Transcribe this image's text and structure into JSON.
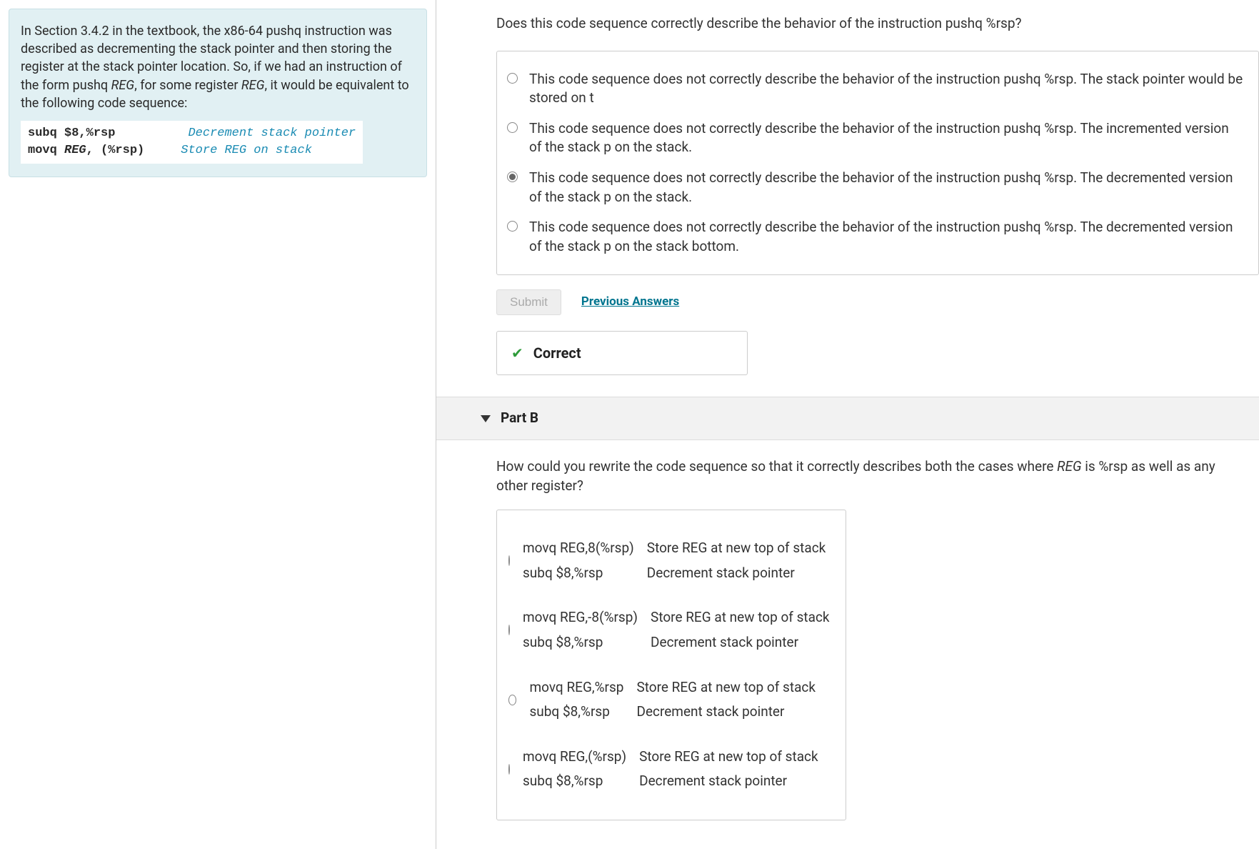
{
  "left": {
    "intro_html": "In Section 3.4.2 in the textbook, the x86-64 pushq instruction was described as decrementing the stack pointer and then storing the register at the stack pointer location. So, if we had an instruction of the form pushq <span class='reg-em'>REG</span>, for some register <span class='reg-em'>REG</span>, it would be equivalent to the following code sequence:",
    "code": {
      "l1_instr": "subq $8,%rsp",
      "l1_pad": "          ",
      "l1_comment": "Decrement stack pointer",
      "l2_instr_a": "movq ",
      "l2_instr_b": "REG",
      "l2_instr_c": ", (%rsp)",
      "l2_pad": "     ",
      "l2_comment": "Store REG on stack"
    }
  },
  "partA": {
    "prompt": "Does this code sequence correctly describe the behavior of the instruction pushq %rsp?",
    "options": [
      "This code sequence does not correctly describe the behavior of the instruction pushq %rsp. The stack pointer would be stored on t",
      "This code sequence does not correctly describe the behavior of the instruction pushq %rsp. The incremented version of the stack p on the stack.",
      "This code sequence does not correctly describe the behavior of the instruction pushq %rsp. The decremented version of the stack p on the stack.",
      "This code sequence does not correctly describe the behavior of the instruction pushq %rsp. The decremented version of the stack p on the stack bottom."
    ],
    "selected": 2,
    "submit": "Submit",
    "prev": "Previous Answers",
    "feedback": "Correct"
  },
  "partB": {
    "title": "Part B",
    "prompt_html": "How could you rewrite the code sequence so that it correctly describes both the cases where <span class='reg-em'>REG</span> is %rsp as well as any other register?",
    "options": [
      {
        "rows": [
          [
            "movq REG,8(%rsp)",
            "Store REG at new top of stack"
          ],
          [
            "subq $8,%rsp",
            "Decrement stack pointer"
          ]
        ]
      },
      {
        "rows": [
          [
            "movq REG,-8(%rsp)",
            "Store REG at new top of stack"
          ],
          [
            "subq $8,%rsp",
            "Decrement stack pointer"
          ]
        ]
      },
      {
        "rows": [
          [
            "movq REG,%rsp",
            "Store REG at new top of stack"
          ],
          [
            "subq $8,%rsp",
            "Decrement stack pointer"
          ]
        ]
      },
      {
        "rows": [
          [
            "movq REG,(%rsp)",
            "Store REG at new top of stack"
          ],
          [
            "subq $8,%rsp",
            "Decrement stack pointer"
          ]
        ]
      }
    ],
    "selected": -1
  }
}
